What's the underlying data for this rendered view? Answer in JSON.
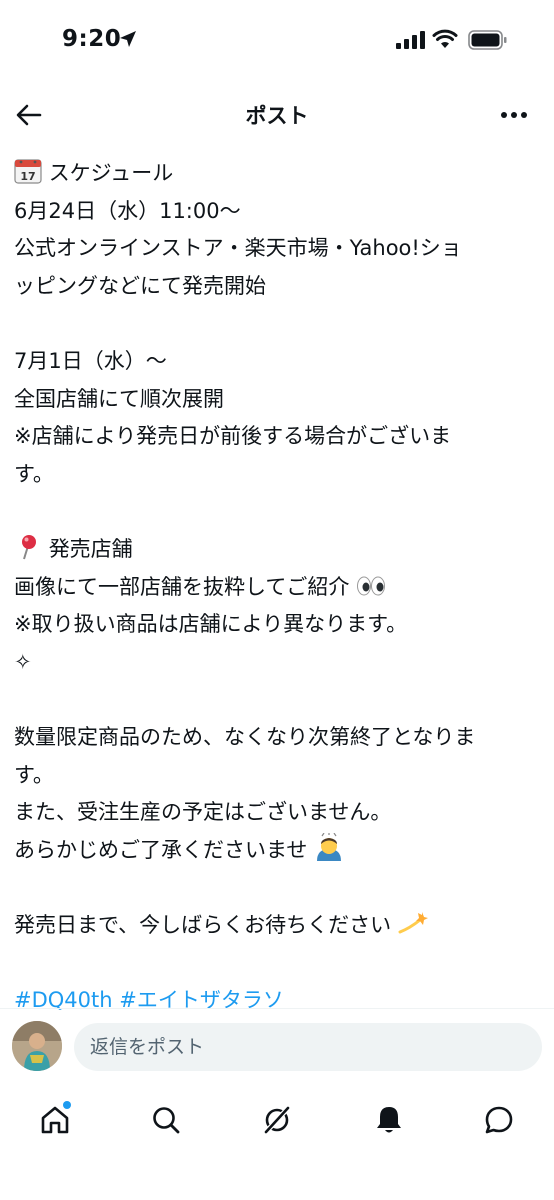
{
  "status": {
    "time": "9:20"
  },
  "nav": {
    "title": "ポスト"
  },
  "post": {
    "lines": [
      "スケジュール",
      "6月24日（水）11:00〜",
      "公式オンラインストア・楽天市場・Yahoo!ショ",
      "ッピングなどにて発売開始",
      "7月1日（水）〜",
      "全国店舗にて順次展開",
      "※店舗により発売日が前後する場合がございま",
      "す。",
      "発売店舗",
      "画像にて一部店舗を抜粋してご紹介",
      "※取り扱い商品は店舗により異なります。",
      "✧",
      "数量限定商品のため、なくなり次第終了となりま",
      "す。",
      "また、受注生産の予定はございません。",
      "あらかじめご了承くださいませ",
      "発売日まで、今しばらくお待ちください"
    ],
    "hashtags": [
      "#DQ40th",
      "#エイトザタラソ"
    ]
  },
  "reply": {
    "placeholder": "返信をポスト"
  },
  "icons": {
    "calendar": "calendar-icon",
    "pin": "round-pushpin-icon",
    "eyes": "eyes-icon",
    "bow": "bowing-person-icon",
    "dizzy": "dizzy-icon"
  },
  "tabs": [
    "home",
    "search",
    "grok",
    "notifications",
    "messages"
  ],
  "colors": {
    "accent": "#1d9bf0",
    "text": "#0f1419",
    "muted": "#536471",
    "input_bg": "#eff3f4"
  }
}
